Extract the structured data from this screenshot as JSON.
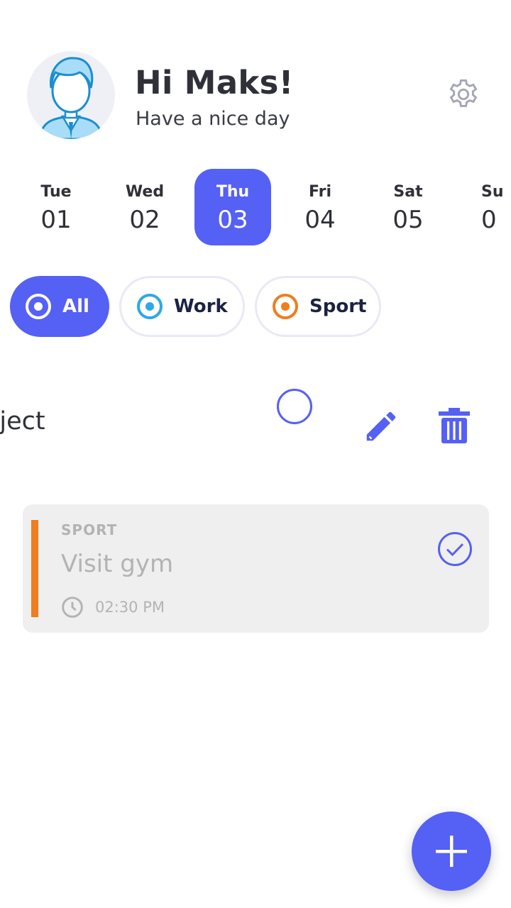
{
  "header": {
    "greeting": "Hi Maks!",
    "subtitle": "Have a nice day",
    "avatar_icon": "user-avatar-icon",
    "settings_icon": "gear-icon"
  },
  "days": [
    {
      "name": "Tue",
      "num": "01",
      "active": false
    },
    {
      "name": "Wed",
      "num": "02",
      "active": false
    },
    {
      "name": "Thu",
      "num": "03",
      "active": true
    },
    {
      "name": "Fri",
      "num": "04",
      "active": false
    },
    {
      "name": "Sat",
      "num": "05",
      "active": false
    },
    {
      "name": "Su",
      "num": "0",
      "active": false
    }
  ],
  "filters": [
    {
      "label": "All",
      "active": true,
      "color": "#ffffff"
    },
    {
      "label": "Work",
      "active": false,
      "color": "#2ea8e6"
    },
    {
      "label": "Sport",
      "active": false,
      "color": "#f07d1e"
    }
  ],
  "swiped_task": {
    "title_fragment": "oject",
    "edit_icon": "pencil-icon",
    "delete_icon": "trash-icon"
  },
  "task": {
    "category": "SPORT",
    "title": "Visit gym",
    "time": "02:30 PM",
    "category_color": "#f07d1e",
    "done": true
  },
  "colors": {
    "accent": "#5560f5",
    "work": "#2ea8e6",
    "sport": "#f07d1e"
  },
  "fab_icon": "plus-icon"
}
